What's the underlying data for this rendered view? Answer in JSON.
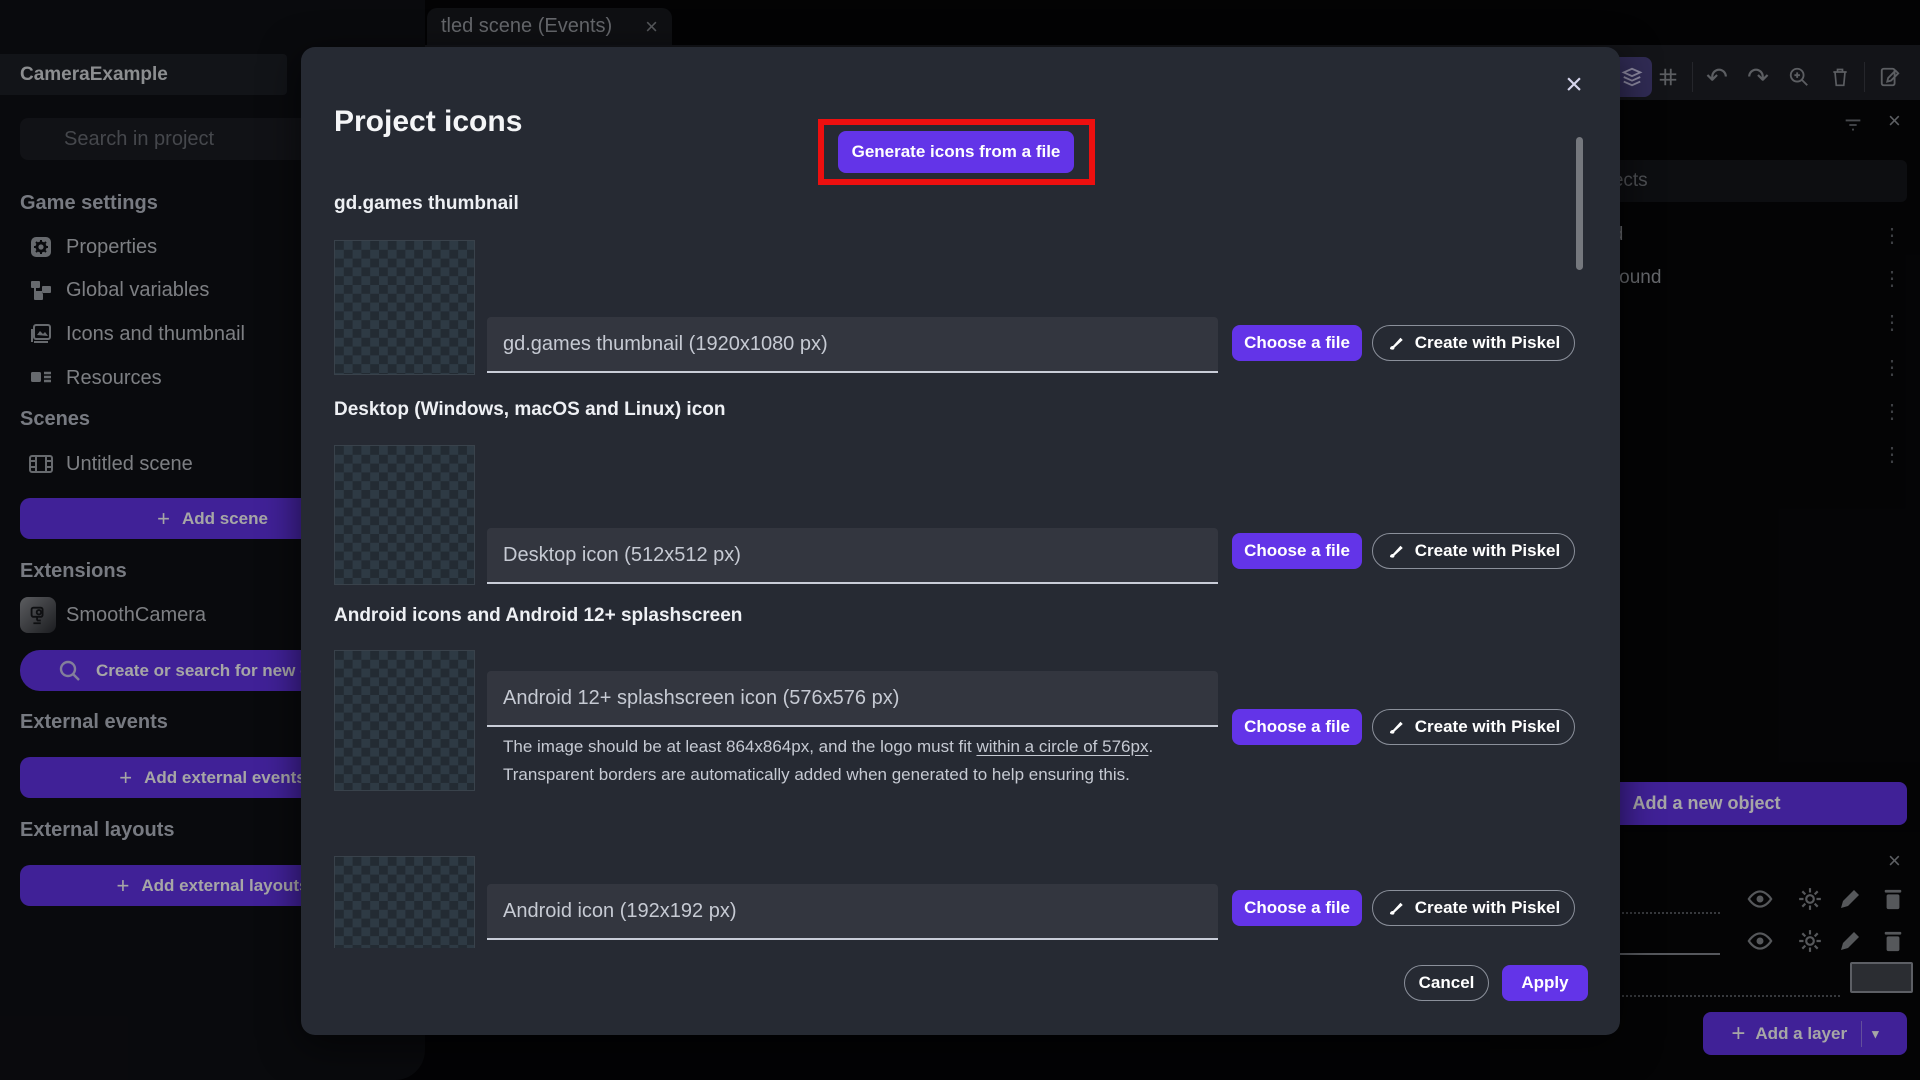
{
  "window": {
    "tab": {
      "label": "tled scene (Events)",
      "close_glyph": "×"
    }
  },
  "toolbar": {
    "undo_glyph": "↶",
    "redo_glyph": "↷",
    "icons": [
      "layers-icon",
      "grid-icon",
      "undo-icon",
      "redo-icon",
      "zoom-in-icon",
      "trash-icon",
      "edit-note-icon"
    ]
  },
  "project_panel": {
    "title": "CameraExample",
    "search_placeholder": "Search in project",
    "game_settings": {
      "label": "Game settings",
      "items": [
        {
          "label": "Properties"
        },
        {
          "label": "Global variables"
        },
        {
          "label": "Icons and thumbnail"
        },
        {
          "label": "Resources"
        }
      ]
    },
    "scenes": {
      "label": "Scenes",
      "scene_name": "Untitled scene",
      "add_button": "Add scene"
    },
    "extensions": {
      "label": "Extensions",
      "extension_name": "SmoothCamera",
      "search_button": "Create or search for new extensions"
    },
    "external_events": {
      "label": "External events",
      "add_button": "Add external events"
    },
    "external_layouts": {
      "label": "External layouts",
      "add_button": "Add external layouts"
    }
  },
  "objects_panel": {
    "search_placeholder": "Search objects",
    "kebab_glyph": "⋮",
    "close_glyph": "×",
    "objects": [
      {
        "label": "Ground"
      },
      {
        "label": "Background"
      },
      {
        "label": ""
      },
      {
        "label": ""
      },
      {
        "label": ""
      },
      {
        "label": ""
      }
    ],
    "add_button": "Add a new object"
  },
  "layers_panel": {
    "close_glyph": "×",
    "add_button": "Add a layer",
    "plus_glyph": "+",
    "caret_glyph": "▾"
  },
  "modal": {
    "title": "Project icons",
    "close_glyph": "×",
    "generate_button": "Generate icons from a file",
    "section_headers": [
      "gd.games thumbnail",
      "Desktop (Windows, macOS and Linux) icon",
      "Android icons and Android 12+ splashscreen"
    ],
    "rows": [
      {
        "placeholder": "gd.games thumbnail (1920x1080 px)",
        "choose": "Choose a file",
        "piskel": "Create with Piskel"
      },
      {
        "placeholder": "Desktop icon (512x512 px)",
        "choose": "Choose a file",
        "piskel": "Create with Piskel"
      },
      {
        "placeholder": "Android 12+ splashscreen icon (576x576 px)",
        "choose": "Choose a file",
        "piskel": "Create with Piskel"
      },
      {
        "placeholder": "Android icon (192x192 px)",
        "choose": "Choose a file",
        "piskel": "Create with Piskel"
      }
    ],
    "help": {
      "line1_prefix": "The image should be at least 864x864px, and the logo must fit ",
      "line1_underlined": "within a circle of 576px",
      "line1_suffix": ".",
      "line2": "Transparent borders are automatically added when generated to help ensuring this."
    },
    "cancel_button": "Cancel",
    "apply_button": "Apply"
  },
  "colors": {
    "primary": "#6334e8",
    "annotation_red": "#ed0f0f",
    "modal_bg": "#262a33"
  }
}
